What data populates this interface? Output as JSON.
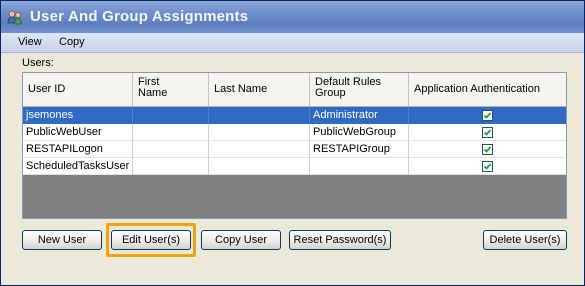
{
  "window": {
    "title": "User And Group Assignments",
    "icon": "users-icon"
  },
  "menu": {
    "items": [
      "View",
      "Copy"
    ]
  },
  "users_label": "Users:",
  "grid": {
    "columns": [
      {
        "label": "User ID"
      },
      {
        "label": "First Name"
      },
      {
        "label": "Last Name"
      },
      {
        "label": "Default Rules Group"
      },
      {
        "label": "Application Authentication"
      }
    ],
    "rows": [
      {
        "user_id": "jsemones",
        "first_name": "",
        "last_name": "",
        "group": "Administrator",
        "auth": true,
        "selected": true
      },
      {
        "user_id": "PublicWebUser",
        "first_name": "",
        "last_name": "",
        "group": "PublicWebGroup",
        "auth": true,
        "selected": false
      },
      {
        "user_id": "RESTAPILogon",
        "first_name": "",
        "last_name": "",
        "group": "RESTAPIGroup",
        "auth": true,
        "selected": false
      },
      {
        "user_id": "ScheduledTasksUser",
        "first_name": "",
        "last_name": "",
        "group": "",
        "auth": true,
        "selected": false
      }
    ]
  },
  "buttons": {
    "new_user": "New User",
    "edit_users": "Edit User(s)",
    "copy_user": "Copy User",
    "reset_password": "Reset Password(s)",
    "delete_users": "Delete User(s)"
  },
  "colors": {
    "selection": "#316ac5",
    "highlight": "#f0a30a",
    "empty_area": "#808080"
  }
}
